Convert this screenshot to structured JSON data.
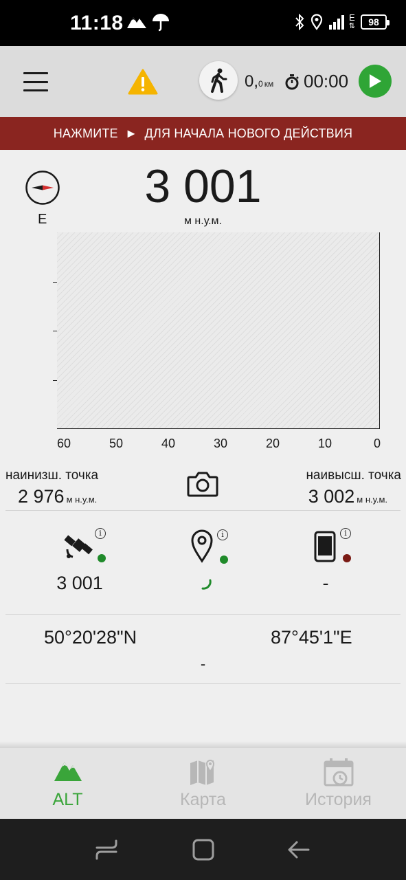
{
  "status_bar": {
    "time": "11:18",
    "network_letter": "E",
    "battery": "98"
  },
  "toolbar": {
    "distance_int": "0,",
    "distance_dec": "0",
    "distance_unit": "км",
    "timer": "00:00"
  },
  "banner": {
    "text": "НАЖМИТЕ  ►  ДЛЯ НАЧАЛА НОВОГО ДЕЙСТВИЯ"
  },
  "altitude": {
    "compass_dir": "E",
    "value": "3 001",
    "unit": "м н.у.м."
  },
  "chart_data": {
    "type": "line",
    "x_ticks": [
      "60",
      "50",
      "40",
      "30",
      "20",
      "10",
      "0"
    ],
    "xlim": [
      60,
      0
    ],
    "y_tick_count": 3,
    "series": [],
    "grid": false
  },
  "stats": {
    "low_label": "наинизш. точка",
    "low_value": "2 976",
    "low_unit": "м н.у.м.",
    "high_label": "наивысш. точка",
    "high_value": "3 002",
    "high_unit": "м н.у.м."
  },
  "sensors": {
    "gps_value": "3 001",
    "phone_value": "-",
    "colors": {
      "ok": "#1f8a2a",
      "bad": "#7a1a14"
    }
  },
  "coords": {
    "lat": "50°20'28\"N",
    "lon": "87°45'1\"E",
    "sub": "-"
  },
  "tabs": [
    {
      "label": "ALT",
      "active": true
    },
    {
      "label": "Карта",
      "active": false
    },
    {
      "label": "История",
      "active": false
    }
  ],
  "colors": {
    "accent_green": "#3aa53a",
    "banner_red": "#8a2520",
    "tab_inactive": "#b7b7b7"
  }
}
